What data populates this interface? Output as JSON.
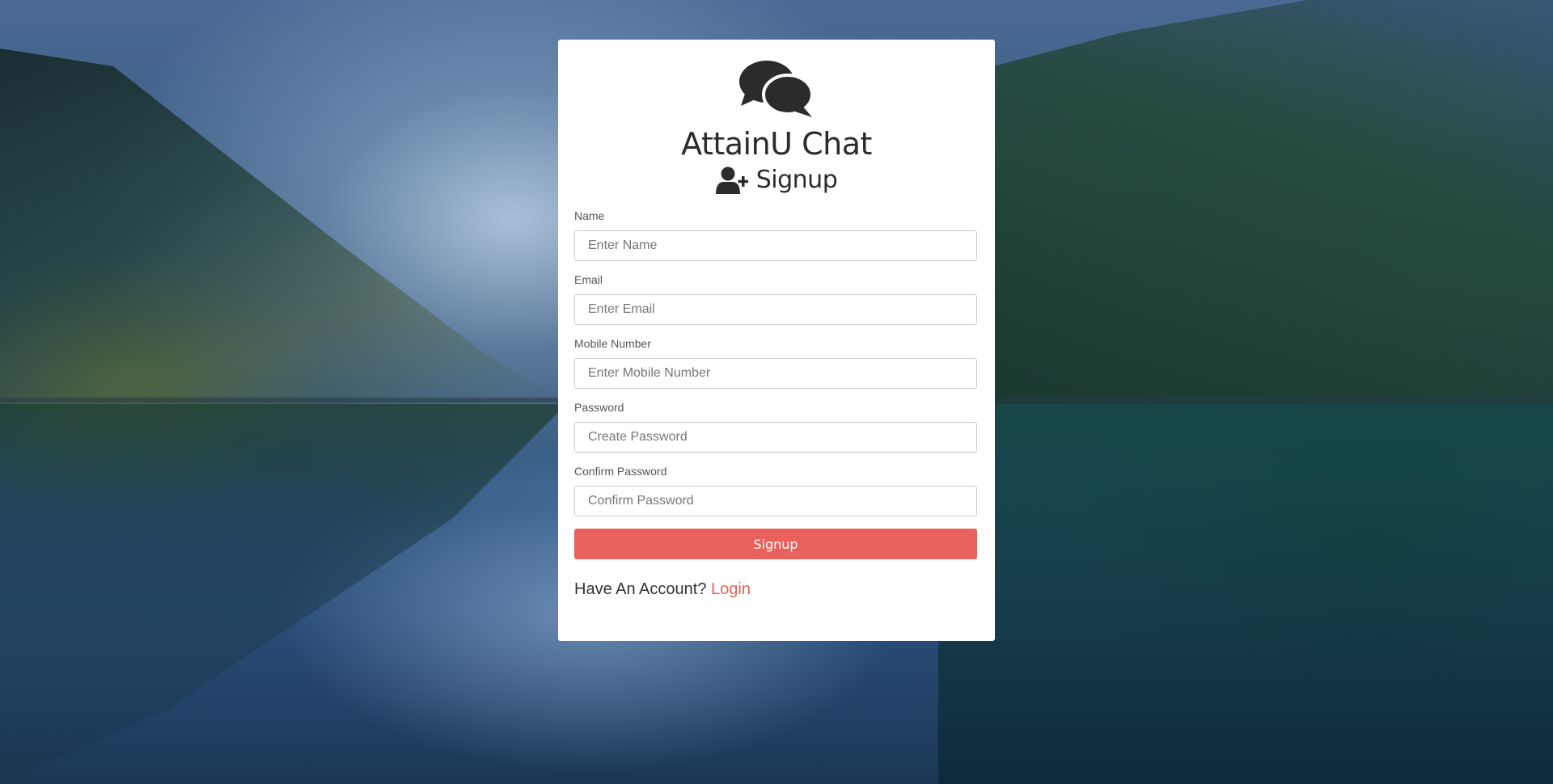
{
  "app": {
    "title": "AttainU Chat",
    "logo_icon": "comments-icon"
  },
  "page": {
    "heading": "Signup",
    "heading_icon": "user-plus-icon"
  },
  "form": {
    "fields": [
      {
        "label": "Name",
        "placeholder": "Enter Name",
        "value": ""
      },
      {
        "label": "Email",
        "placeholder": "Enter Email",
        "value": ""
      },
      {
        "label": "Mobile Number",
        "placeholder": "Enter Mobile Number",
        "value": ""
      },
      {
        "label": "Password",
        "placeholder": "Create Password",
        "value": ""
      },
      {
        "label": "Confirm Password",
        "placeholder": "Confirm Password",
        "value": ""
      }
    ],
    "submit_label": "Signup"
  },
  "footer": {
    "prompt": "Have An Account?",
    "link_label": "Login"
  },
  "colors": {
    "accent": "#e9615c",
    "text_dark": "#2b2b2b",
    "card_bg": "#ffffff"
  }
}
